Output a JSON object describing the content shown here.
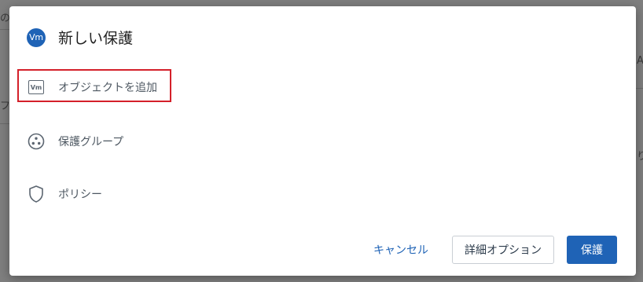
{
  "background": {
    "frag_left_top": "の",
    "frag_left_mid": "フ",
    "frag_right_top": "A",
    "frag_right_mid": "り"
  },
  "dialog": {
    "badge": "Vm",
    "title": "新しい保護",
    "options": [
      {
        "label": "オブジェクトを追加",
        "icon": "vm-icon",
        "icon_text": "Vm"
      },
      {
        "label": "保護グループ",
        "icon": "protection-group-icon"
      },
      {
        "label": "ポリシー",
        "icon": "shield-icon"
      }
    ],
    "buttons": {
      "cancel": "キャンセル",
      "advanced": "詳細オプション",
      "protect": "保護"
    }
  },
  "colors": {
    "accent": "#1f63b6",
    "highlight": "#d4202a"
  }
}
